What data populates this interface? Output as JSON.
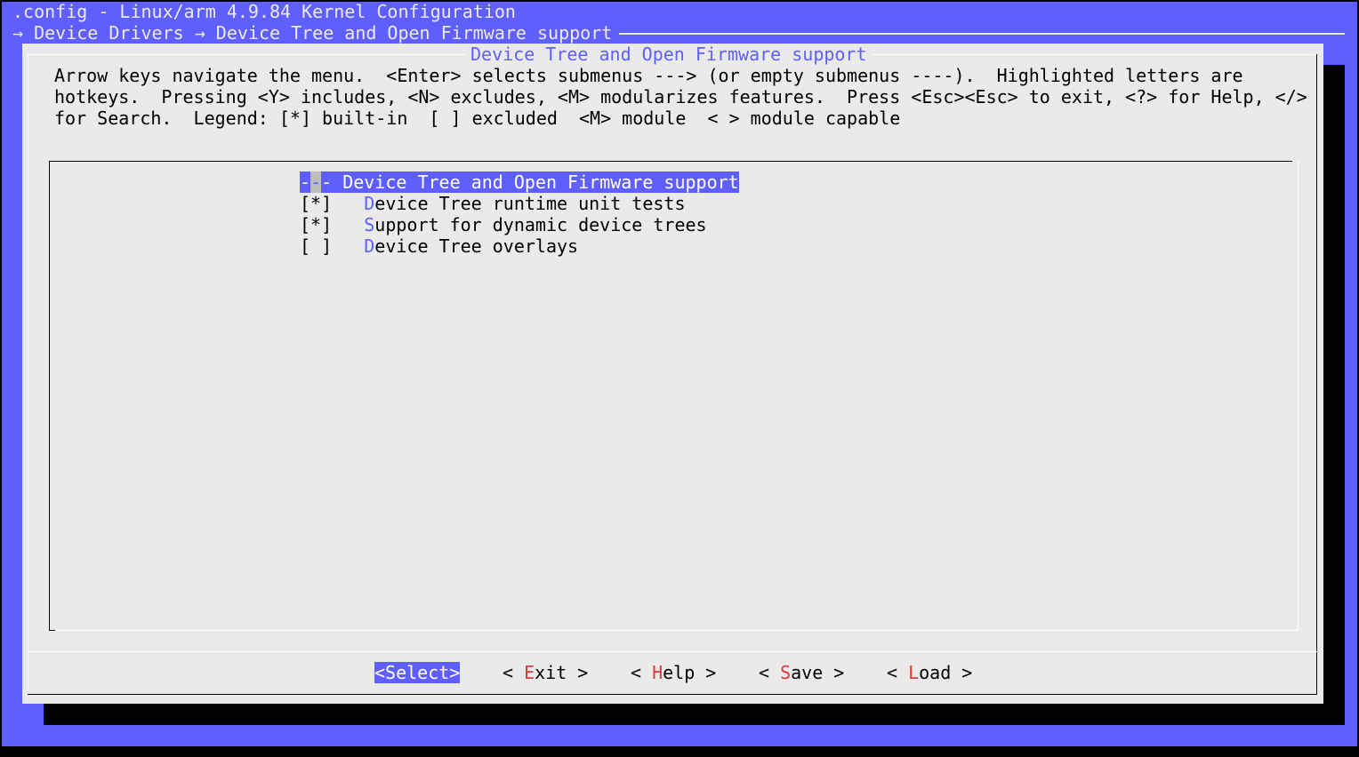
{
  "window": {
    "title": ".config - Linux/arm 4.9.84 Kernel Configuration",
    "breadcrumb": "→ Device Drivers → Device Tree and Open Firmware support"
  },
  "dialog": {
    "title": "Device Tree and Open Firmware support",
    "help_lines": [
      "Arrow keys navigate the menu.  <Enter> selects submenus ---> (or empty submenus ----).  Highlighted letters are",
      "hotkeys.  Pressing <Y> includes, <N> excludes, <M> modularizes features.  Press <Esc><Esc> to exit, <?> for Help, </>",
      "for Search.  Legend: [*] built-in  [ ] excluded  <M> module  < > module capable"
    ]
  },
  "menu": {
    "items": [
      {
        "prefix_a": "-",
        "prefix_cursor": "-",
        "prefix_b": "- ",
        "hotkey": "",
        "rest": "Device Tree and Open Firmware support",
        "selected": true
      },
      {
        "prefix": "[*]   ",
        "hotkey": "D",
        "rest": "evice Tree runtime unit tests"
      },
      {
        "prefix": "[*]   ",
        "hotkey": "S",
        "rest": "upport for dynamic device trees"
      },
      {
        "prefix": "[ ]   ",
        "hotkey": "D",
        "rest": "evice Tree overlays"
      }
    ]
  },
  "buttons": {
    "select": "<Select>",
    "exit": {
      "lead": "< ",
      "hotkey": "E",
      "rest": "xit",
      "trail": " >"
    },
    "help": {
      "lead": "< ",
      "hotkey": "H",
      "rest": "elp",
      "trail": " >"
    },
    "save": {
      "lead": "< ",
      "hotkey": "S",
      "rest": "ave",
      "trail": " >"
    },
    "load": {
      "lead": "< ",
      "hotkey": "L",
      "rest": "oad",
      "trail": " >"
    }
  },
  "colors": {
    "background": "#5f5fff",
    "dialog": "#eaeaea",
    "highlight": "#5f5fff",
    "button_hotkey": "#e03a3a"
  }
}
